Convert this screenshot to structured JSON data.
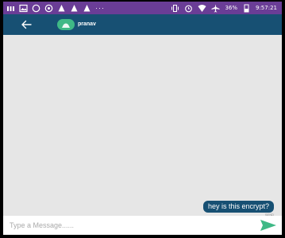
{
  "status_bar": {
    "battery_percent": "36%",
    "time": "9:57:21",
    "more_indicator": "···",
    "left_icons": [
      "app-icon",
      "image-icon",
      "whatsapp-icon",
      "notification-icon",
      "notification-icon",
      "notification-icon"
    ],
    "right_icons": [
      "vibrate-icon",
      "alarm-icon",
      "wifi-icon",
      "airplane-icon",
      "battery-icon"
    ]
  },
  "app_bar": {
    "contact_name": "pranav"
  },
  "messages": [
    {
      "text": "hey is this encrypt?",
      "status": "SEND",
      "outgoing": true
    }
  ],
  "composer": {
    "placeholder": "Type a Message......"
  },
  "colors": {
    "status_bar": "#6a3d96",
    "app_bar": "#175073",
    "avatar": "#3fb986",
    "chat_background": "#e6e6e6",
    "send_arrow": "#3fb986",
    "page_background": "#fff8c6"
  }
}
